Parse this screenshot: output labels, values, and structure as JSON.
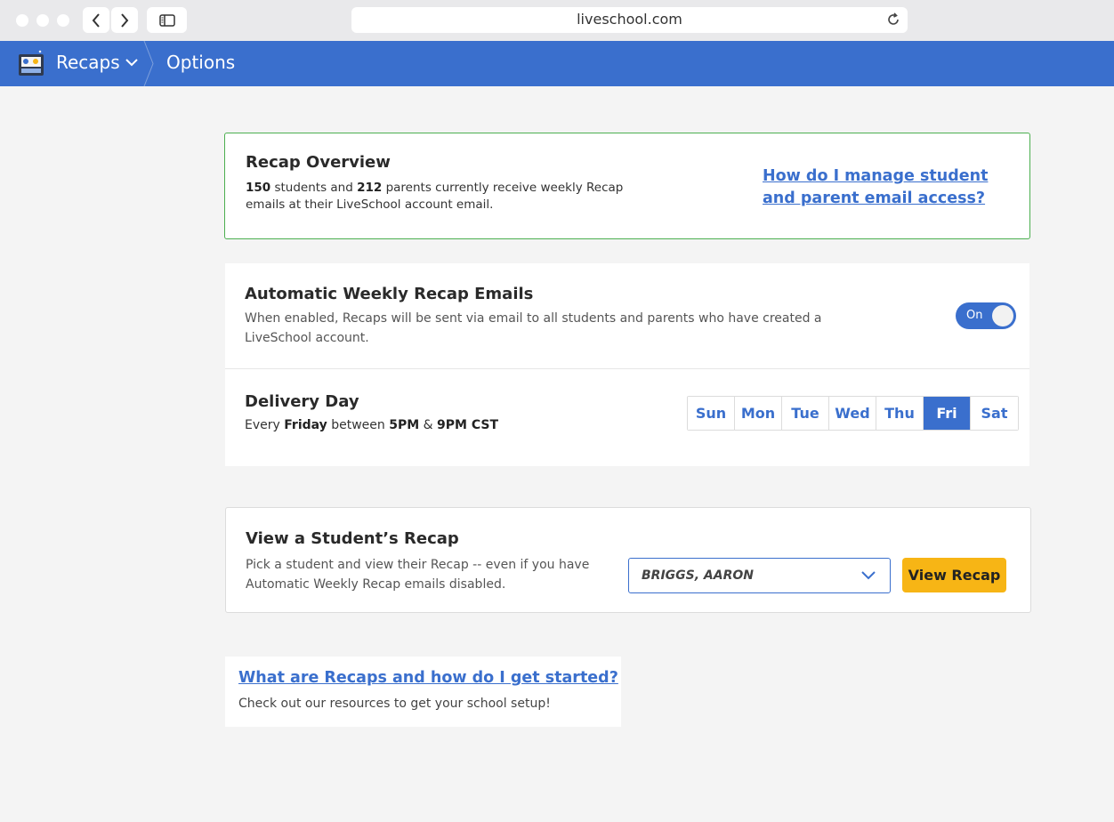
{
  "browser": {
    "url": "liveschool.com"
  },
  "header": {
    "app_name": "Recaps",
    "page_title": "Options"
  },
  "overview": {
    "title": "Recap Overview",
    "students_count": "150",
    "text_after_students": " students and ",
    "parents_count": "212",
    "text_after_parents": " parents currently receive weekly Recap emails at their LiveSchool account email.",
    "help_link": "How do I manage student and parent email access?"
  },
  "automatic": {
    "title": "Automatic Weekly Recap Emails",
    "description": "When enabled, Recaps will be sent via email to all students and parents who have created a LiveSchool account.",
    "toggle_label": "On",
    "toggle_state": "on"
  },
  "delivery": {
    "title": "Delivery Day",
    "text_every": "Every ",
    "day_full": "Friday",
    "text_between": " between ",
    "time_start": "5PM",
    "text_and": " & ",
    "time_end": "9PM CST",
    "days": [
      "Sun",
      "Mon",
      "Tue",
      "Wed",
      "Thu",
      "Fri",
      "Sat"
    ],
    "selected_day": "Fri"
  },
  "view_recap": {
    "title": "View a Student’s Recap",
    "description": "Pick a student and view their Recap -- even if you have Automatic Weekly Recap emails disabled.",
    "selected_student": "BRIGGS, AARON",
    "button_label": "View Recap"
  },
  "resources": {
    "link": "What are Recaps and how do I get started?",
    "description": "Check out our resources to get your school setup!"
  },
  "colors": {
    "brand_blue": "#3a6fcd",
    "overview_border": "#4caf50",
    "button_yellow": "#f7b515"
  }
}
